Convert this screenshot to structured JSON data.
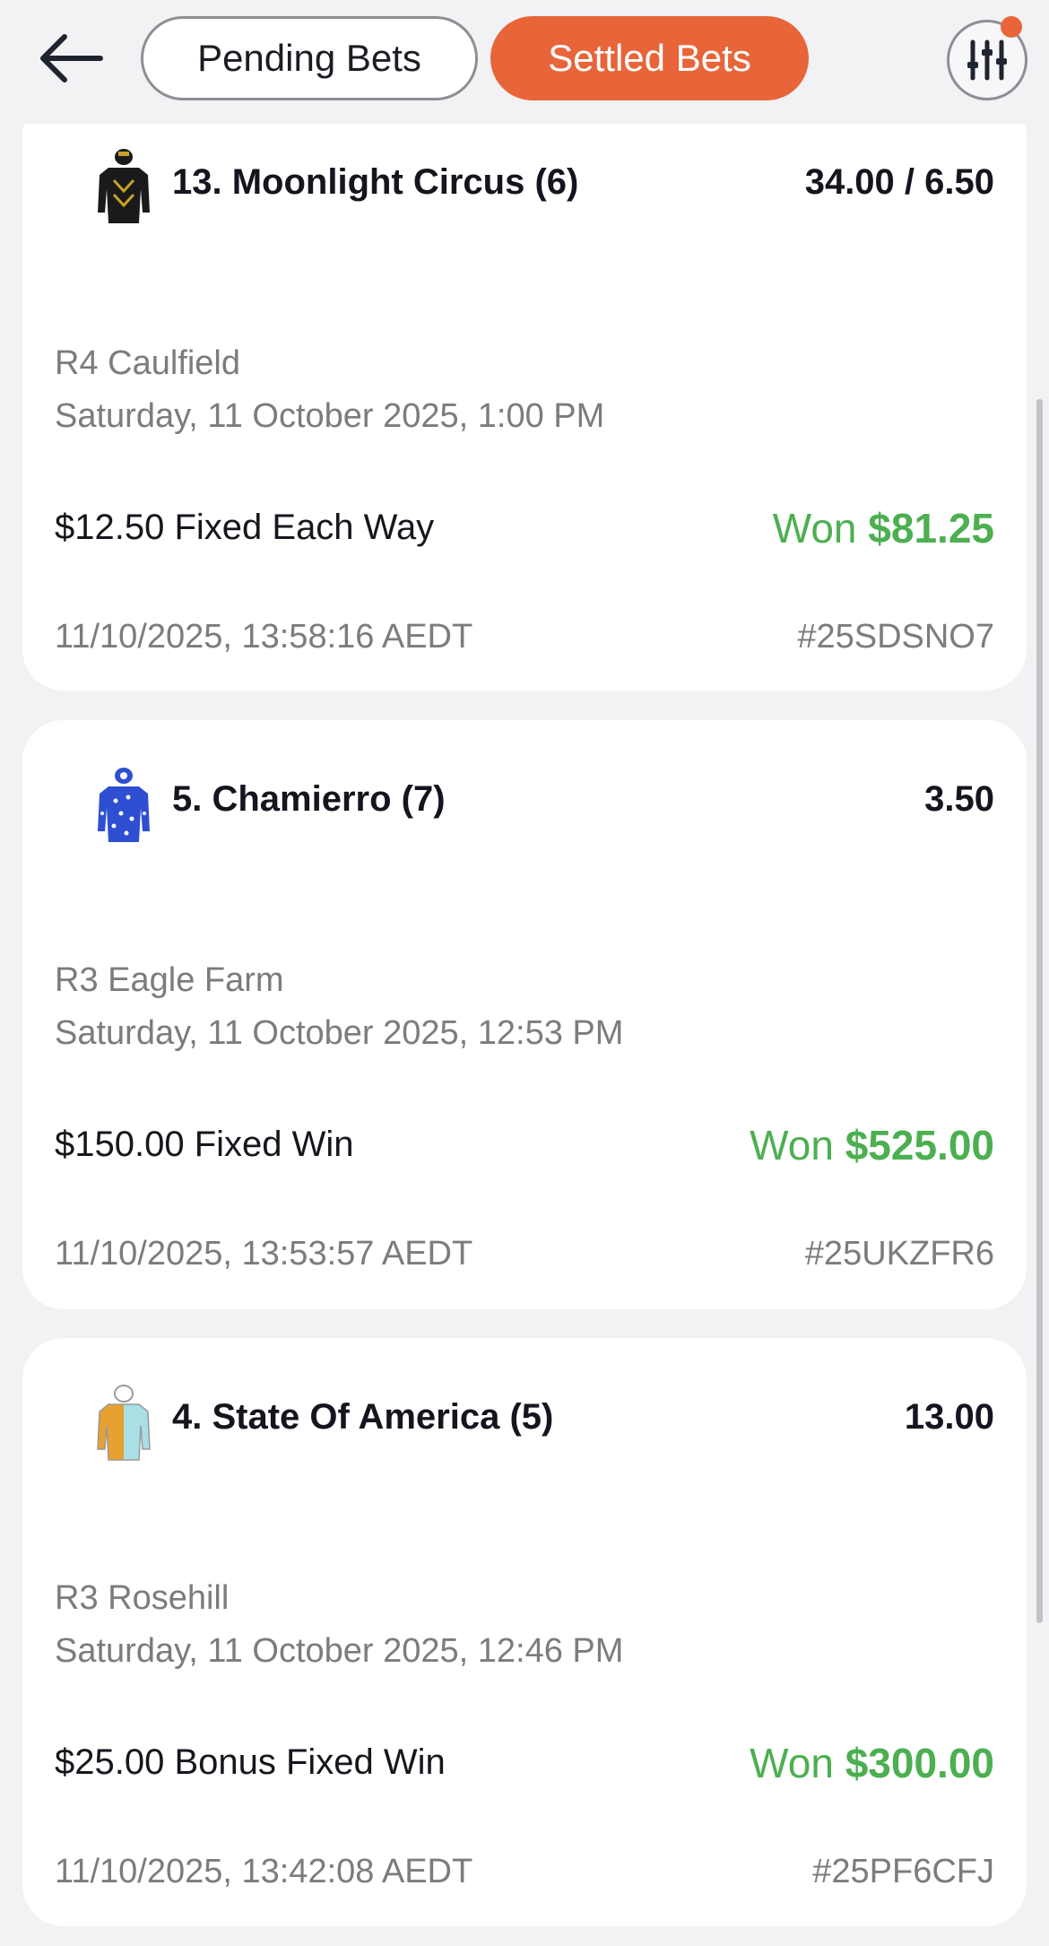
{
  "header": {
    "back_label": "Back",
    "tabs": [
      {
        "label": "Pending Bets",
        "active": false
      },
      {
        "label": "Settled Bets",
        "active": true
      }
    ],
    "filter_icon": "sliders-icon",
    "filter_has_notification": true
  },
  "colors": {
    "accent": "#e8653a",
    "won": "#4caf50",
    "text_primary": "#15151f",
    "text_secondary": "#7b7b80",
    "background": "#f2f2f4"
  },
  "bets": [
    {
      "runner": "13. Moonlight Circus (6)",
      "odds": "34.00 / 6.50",
      "venue": "R4 Caulfield",
      "race_time": "Saturday, 11 October 2025, 1:00 PM",
      "bet_type": "$12.50 Fixed Each Way",
      "result_label": "Won",
      "result_amount": "$81.25",
      "placed_at": "11/10/2025, 13:58:16 AEDT",
      "bet_id": "#25SDSNO7",
      "silk_icon": "jockey-silk-black-gold-icon"
    },
    {
      "runner": "5. Chamierro (7)",
      "odds": "3.50",
      "venue": "R3 Eagle Farm",
      "race_time": "Saturday, 11 October 2025, 12:53 PM",
      "bet_type": "$150.00 Fixed Win",
      "result_label": "Won",
      "result_amount": "$525.00",
      "placed_at": "11/10/2025, 13:53:57 AEDT",
      "bet_id": "#25UKZFR6",
      "silk_icon": "jockey-silk-blue-icon"
    },
    {
      "runner": "4. State Of America (5)",
      "odds": "13.00",
      "venue": "R3 Rosehill",
      "race_time": "Saturday, 11 October 2025, 12:46 PM",
      "bet_type": "$25.00 Bonus Fixed Win",
      "result_label": "Won",
      "result_amount": "$300.00",
      "placed_at": "11/10/2025, 13:42:08 AEDT",
      "bet_id": "#25PF6CFJ",
      "silk_icon": "jockey-silk-orange-aqua-icon"
    }
  ]
}
